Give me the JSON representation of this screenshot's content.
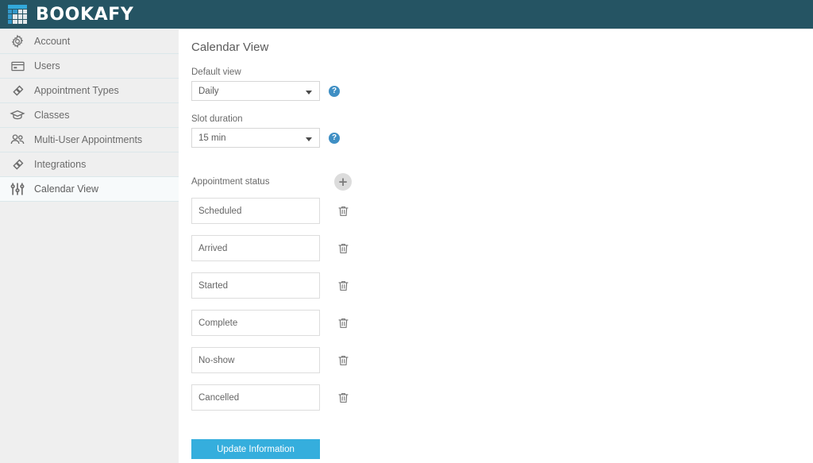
{
  "brand": {
    "name": "BOOKAFY",
    "logo_icon": "calendar-grid-icon",
    "header_bg": "#255463",
    "logo_blue": "#32a8da"
  },
  "sidebar": {
    "items": [
      {
        "label": "Account",
        "icon": "gear-icon",
        "active": false
      },
      {
        "label": "Users",
        "icon": "card-icon",
        "active": false
      },
      {
        "label": "Appointment Types",
        "icon": "link-icon",
        "active": false
      },
      {
        "label": "Classes",
        "icon": "graduation-cap-icon",
        "active": false
      },
      {
        "label": "Multi-User Appointments",
        "icon": "users-group-icon",
        "active": false
      },
      {
        "label": "Integrations",
        "icon": "link-icon",
        "active": false
      },
      {
        "label": "Calendar View",
        "icon": "sliders-icon",
        "active": true
      }
    ]
  },
  "main": {
    "title": "Calendar View",
    "default_view": {
      "label": "Default view",
      "value": "Daily",
      "help_icon": "question-mark-icon",
      "help_text": "?"
    },
    "slot_duration": {
      "label": "Slot duration",
      "value": "15 min",
      "help_icon": "question-mark-icon",
      "help_text": "?"
    },
    "appointment_status": {
      "label": "Appointment status",
      "add_label": "+",
      "add_icon": "plus-icon",
      "delete_icon": "trash-icon",
      "items": [
        {
          "value": "Scheduled"
        },
        {
          "value": "Arrived"
        },
        {
          "value": "Started"
        },
        {
          "value": "Complete"
        },
        {
          "value": "No-show"
        },
        {
          "value": "Cancelled"
        }
      ]
    },
    "update_button": {
      "label": "Update Information",
      "color": "#35aedd"
    }
  }
}
